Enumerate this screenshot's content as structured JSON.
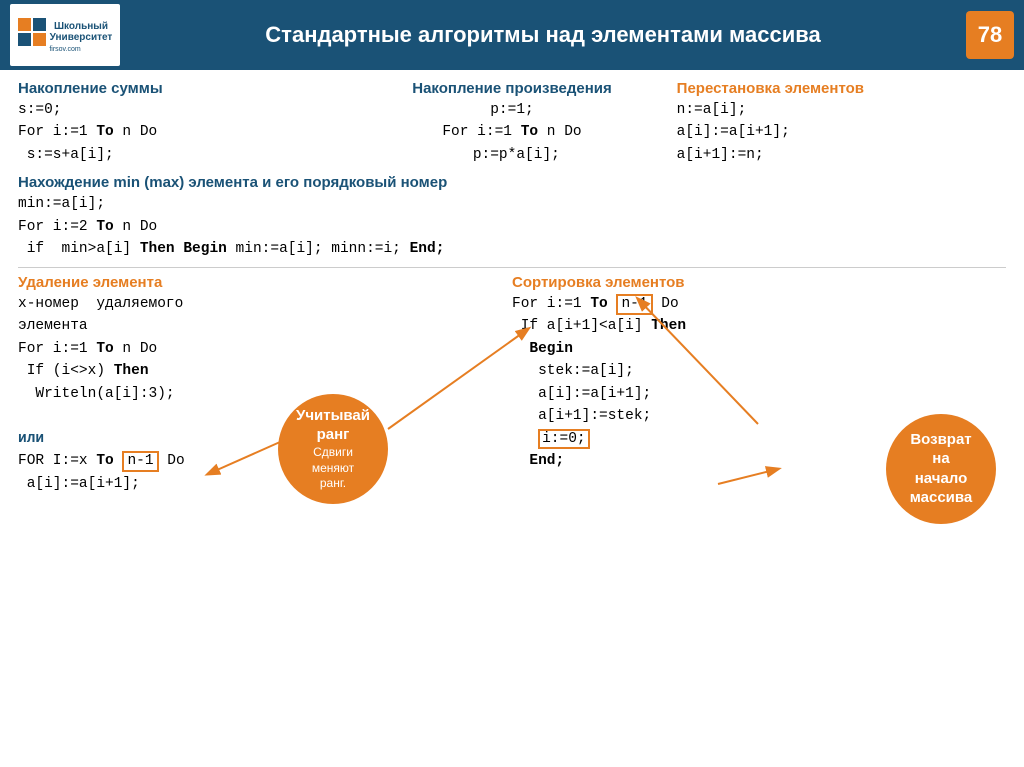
{
  "header": {
    "title": "Стандартные алгоритмы над элементами массива",
    "page_number": "78",
    "logo_line1": "Школьный",
    "logo_line2": "Университет",
    "logo_sub": "firsov.com"
  },
  "section1": {
    "title": "Накопление суммы",
    "lines": [
      "s:=0;",
      "For i:=1 To n Do",
      " s:=s+a[i];"
    ]
  },
  "section2": {
    "title": "Накопление произведения",
    "lines": [
      "p:=1;",
      "For i:=1 To n Do",
      " p:=p*a[i];"
    ]
  },
  "section3": {
    "title": "Перестановка элементов",
    "lines": [
      "n:=a[i];",
      "a[i]:=a[i+1];",
      "a[i+1]:=n;"
    ]
  },
  "section_mid": {
    "title": "Нахождение  min (max) элемента и его порядковый номер",
    "lines": [
      "min:=a[i];",
      "For i:=2 To n Do",
      " if  min>a[i] Then Begin min:=a[i]; minn:=i; End;"
    ]
  },
  "section_left": {
    "title": "Удаление элемента",
    "lines": [
      "x-номер  удаляемого",
      "элемента",
      "For i:=1 To n Do",
      " If (i<>x) Then",
      "  Writeln(a[i]:3);",
      "",
      "или",
      "FOR I:=x To n-1 Do",
      " a[i]:=a[i+1];"
    ],
    "ili_label": "или"
  },
  "section_right": {
    "title": "Сортировка элементов",
    "lines": [
      "For i:=1 To n-1 Do",
      " If a[i+1]<a[i] Then",
      "  Begin",
      "   stek:=a[i];",
      "   a[i]:=a[i+1];",
      "   a[i+1]:=stek;",
      "   i:=0;",
      "  End;"
    ]
  },
  "callout1": {
    "line1": "Учитывай",
    "line2": "ранг",
    "line3": "Сдвиги",
    "line4": "меняют",
    "line5": "ранг."
  },
  "callout2": {
    "line1": "Возврат",
    "line2": "на",
    "line3": "начало",
    "line4": "массива"
  }
}
